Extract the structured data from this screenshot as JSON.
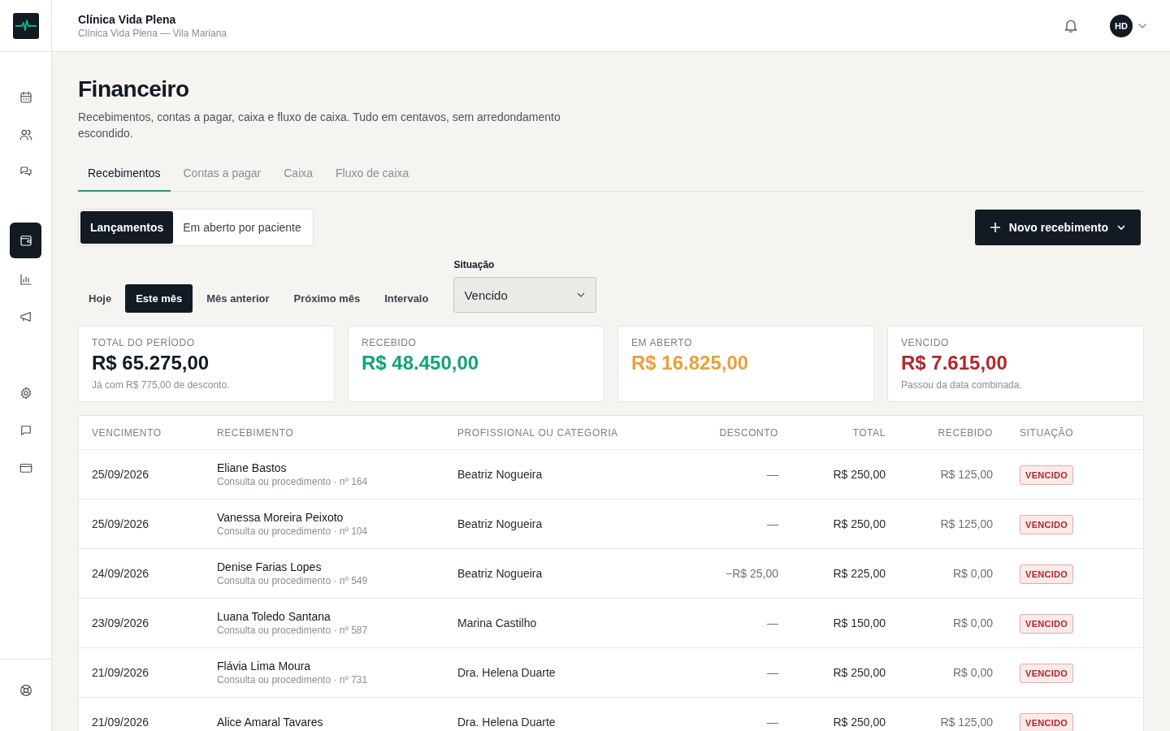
{
  "header": {
    "title": "Clínica Vida Plena",
    "subtitle": "Clínica Vida Plena — Vila Mariana",
    "avatar": "HD"
  },
  "sidebar": {
    "groups": [
      [
        {
          "selected": false
        },
        {
          "selected": false
        },
        {
          "selected": false
        }
      ],
      [
        {
          "selected": true
        },
        {
          "selected": false
        },
        {
          "selected": false
        }
      ],
      [
        {
          "selected": false
        },
        {
          "selected": false
        },
        {
          "selected": false
        }
      ],
      [
        {
          "selected": false
        }
      ]
    ]
  },
  "page": {
    "title": "Financeiro",
    "description": "Recebimentos, contas a pagar, caixa e fluxo de caixa. Tudo em centavos, sem arredondamento escondido."
  },
  "tabs": [
    {
      "label": "Recebimentos",
      "selected": true
    },
    {
      "label": "Contas a pagar",
      "selected": false
    },
    {
      "label": "Caixa",
      "selected": false
    },
    {
      "label": "Fluxo de caixa",
      "selected": false
    }
  ],
  "views": [
    {
      "label": "Lançamentos",
      "selected": true
    },
    {
      "label": "Em aberto por paciente",
      "selected": false
    }
  ],
  "new_button": "Novo recebimento",
  "periods": [
    {
      "label": "Hoje",
      "selected": false
    },
    {
      "label": "Este mês",
      "selected": true
    },
    {
      "label": "Mês anterior",
      "selected": false
    },
    {
      "label": "Próximo mês",
      "selected": false
    },
    {
      "label": "Intervalo",
      "selected": false
    }
  ],
  "status_filter": {
    "label": "Situação",
    "value": "Vencido"
  },
  "summary": [
    {
      "label": "TOTAL DO PERÍODO",
      "value": "R$ 65.275,00",
      "note": "Já com R$ 775,00 de desconto.",
      "color": "#121a24"
    },
    {
      "label": "RECEBIDO",
      "value": "R$ 48.450,00",
      "color": "#10a37f"
    },
    {
      "label": "EM ABERTO",
      "value": "R$ 16.825,00",
      "color": "#e9a03b"
    },
    {
      "label": "VENCIDO",
      "value": "R$ 7.615,00",
      "note": "Passou da data combinada.",
      "color": "#b3262a"
    }
  ],
  "table": {
    "columns": [
      "VENCIMENTO",
      "RECEBIMENTO",
      "PROFISSIONAL OU CATEGORIA",
      "DESCONTO",
      "TOTAL",
      "RECEBIDO",
      "SITUAÇÃO"
    ],
    "rows": [
      {
        "due": "25/09/2026",
        "name": "Eliane Bastos",
        "detail": "Consulta ou procedimento · nº 164",
        "professional": "Beatriz Nogueira",
        "discount": "—",
        "total": "R$ 250,00",
        "received": "R$ 125,00",
        "status": "VENCIDO",
        "kind": "overdue"
      },
      {
        "due": "25/09/2026",
        "name": "Vanessa Moreira Peixoto",
        "detail": "Consulta ou procedimento · nº 104",
        "professional": "Beatriz Nogueira",
        "discount": "—",
        "total": "R$ 250,00",
        "received": "R$ 125,00",
        "status": "VENCIDO",
        "kind": "overdue"
      },
      {
        "due": "24/09/2026",
        "name": "Denise Farias Lopes",
        "detail": "Consulta ou procedimento · nº 549",
        "professional": "Beatriz Nogueira",
        "discount": "−R$ 25,00",
        "total": "R$ 225,00",
        "received": "R$ 0,00",
        "status": "VENCIDO",
        "kind": "overdue"
      },
      {
        "due": "23/09/2026",
        "name": "Luana Toledo Santana",
        "detail": "Consulta ou procedimento · nº 587",
        "professional": "Marina Castilho",
        "discount": "—",
        "total": "R$ 150,00",
        "received": "R$ 0,00",
        "status": "VENCIDO",
        "kind": "overdue"
      },
      {
        "due": "21/09/2026",
        "name": "Flávia Lima Moura",
        "detail": "Consulta ou procedimento · nº 731",
        "professional": "Dra. Helena Duarte",
        "discount": "—",
        "total": "R$ 250,00",
        "received": "R$ 0,00",
        "status": "VENCIDO",
        "kind": "overdue"
      },
      {
        "due": "21/09/2026",
        "name": "Alice Amaral Tavares",
        "professional": "Dra. Helena Duarte",
        "discount": "—",
        "total": "R$ 250,00",
        "received": "R$ 125,00",
        "status": "VENCIDO",
        "kind": "overdue"
      }
    ]
  }
}
